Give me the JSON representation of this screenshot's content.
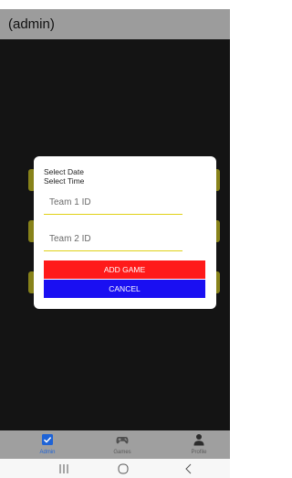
{
  "app_bar": {
    "title": "(admin)"
  },
  "dialog": {
    "select_date": "Select Date",
    "select_time": "Select Time",
    "team1_placeholder": "Team 1 ID",
    "team2_placeholder": "Team 2 ID",
    "add_label": "ADD GAME",
    "cancel_label": "CANCEL"
  },
  "bottom_nav": {
    "items": [
      {
        "label": "Admin",
        "icon": "checkbox-icon",
        "active": true
      },
      {
        "label": "Games",
        "icon": "gamepad-icon",
        "active": false
      },
      {
        "label": "Profile",
        "icon": "person-icon",
        "active": false
      }
    ]
  },
  "system_nav": {
    "icons": [
      "recent-apps-icon",
      "home-icon",
      "back-icon"
    ]
  },
  "colors": {
    "app_bar": "#9c9c9c",
    "content_background": "#141414",
    "add_button": "#ff1a1a",
    "cancel_button": "#1a0ff2",
    "field_underline": "#e0d117",
    "nav_active": "#1e63d6"
  }
}
